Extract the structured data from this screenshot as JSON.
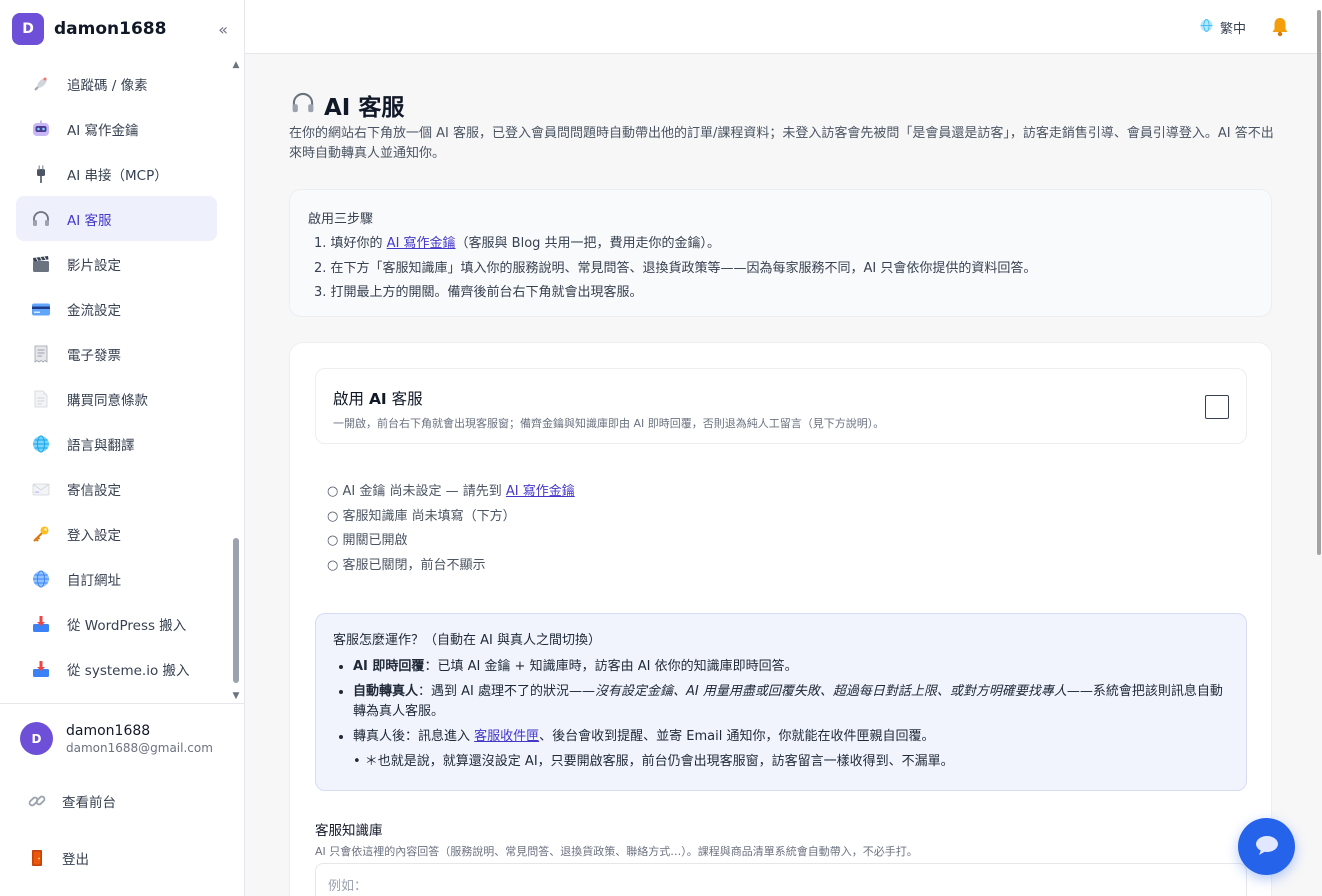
{
  "brand": {
    "initial": "D",
    "name": "damon1688",
    "collapse": "«"
  },
  "sidebar": {
    "items": [
      {
        "label": "追蹤碼 / 像素",
        "icon": "satellite-icon"
      },
      {
        "label": "AI 寫作金鑰",
        "icon": "robot-icon"
      },
      {
        "label": "AI 串接（MCP）",
        "icon": "plug-icon"
      },
      {
        "label": "AI 客服",
        "icon": "headphones-icon",
        "active": true
      },
      {
        "label": "影片設定",
        "icon": "clapperboard-icon"
      },
      {
        "label": "金流設定",
        "icon": "credit-card-icon"
      },
      {
        "label": "電子發票",
        "icon": "receipt-icon"
      },
      {
        "label": "購買同意條款",
        "icon": "document-icon"
      },
      {
        "label": "語言與翻譯",
        "icon": "globe-icon"
      },
      {
        "label": "寄信設定",
        "icon": "envelope-icon"
      },
      {
        "label": "登入設定",
        "icon": "key-icon"
      },
      {
        "label": "自訂網址",
        "icon": "globe-grid-icon"
      },
      {
        "label": "從 WordPress 搬入",
        "icon": "inbox-tray-icon"
      },
      {
        "label": "從 systeme.io 搬入",
        "icon": "inbox-tray-icon"
      }
    ]
  },
  "user": {
    "initial": "D",
    "name": "damon1688",
    "email": "damon1688@gmail.com"
  },
  "bottom_links": {
    "view_frontend": "查看前台",
    "logout": "登出"
  },
  "topbar": {
    "language": "繁中"
  },
  "page": {
    "title": "AI 客服",
    "intro": "在你的網站右下角放一個 AI 客服，已登入會員問問題時自動帶出他的訂單/課程資料；未登入訪客會先被問「是會員還是訪客」，訪客走銷售引導、會員引導登入。AI 答不出來時自動轉真人並通知你。",
    "steps": {
      "title": "啟用三步驟",
      "step1_pre": "1. 填好你的 ",
      "step1_link": "AI 寫作金鑰",
      "step1_post": "（客服與 Blog 共用一把，費用走你的金鑰）。",
      "step2": "2. 在下方「客服知識庫」填入你的服務說明、常見問答、退換貨政策等——因為每家服務不同，AI 只會依你提供的資料回答。",
      "step3": "3. 打開最上方的開關。備齊後前台右下角就會出現客服。"
    },
    "enable": {
      "title_pre": "啟用 ",
      "title_bold": "AI",
      "title_post": " 客服",
      "desc": "一開啟，前台右下角就會出現客服窗；備齊金鑰與知識庫即由 AI 即時回覆，否則退為純人工留言（見下方說明）。"
    },
    "status": {
      "s1_pre": "○ AI 金鑰 尚未設定 — 請先到 ",
      "s1_link": "AI 寫作金鑰",
      "s2": "○ 客服知識庫 尚未填寫（下方）",
      "s3": "○ 開關已開啟",
      "s4": "○ 客服已關閉，前台不顯示"
    },
    "how": {
      "title": "客服怎麼運作？（自動在 AI 與真人之間切換）",
      "b1_bold": "AI 即時回覆",
      "b1_text": "：已填 AI 金鑰 + 知識庫時，訪客由 AI 依你的知識庫即時回答。",
      "b2_bold": "自動轉真人",
      "b2_pre": "：遇到 AI 處理不了的狀況——",
      "b2_italic": "沒有設定金鑰、AI 用量用盡或回覆失敗、超過每日對話上限、或對方明確要找專人",
      "b2_post": "——系統會把該則訊息自動轉為真人客服。",
      "b3_pre": "轉真人後：訊息進入 ",
      "b3_link": "客服收件匣",
      "b3_post": "、後台會收到提醒、並寄 Email 通知你，你就能在收件匣親自回覆。",
      "note": "• ＊也就是說，就算還沒設定 AI，只要開啟客服，前台仍會出現客服窗，訪客留言一樣收得到、不漏單。"
    },
    "kb": {
      "label": "客服知識庫",
      "desc": "AI 只會依這裡的內容回答（服務說明、常見問答、退換貨政策、聯絡方式…）。課程與商品清單系統會自動帶入，不必手打。",
      "placeholder": "例如："
    }
  }
}
